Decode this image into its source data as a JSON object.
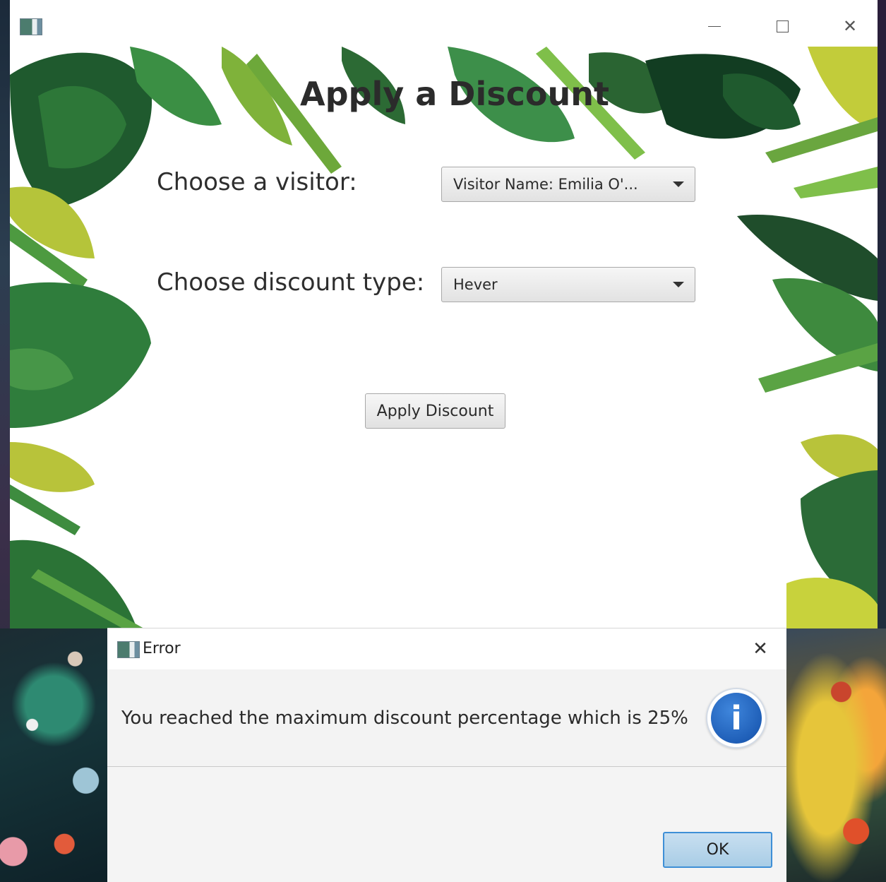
{
  "main_window": {
    "heading": "Apply a Discount",
    "visitor_label": "Choose a visitor:",
    "visitor_selected": "Visitor Name: Emilia O'...",
    "discount_label": "Choose discount type:",
    "discount_selected": "Hever",
    "apply_button": "Apply Discount",
    "controls": {
      "minimize_icon": "minimize-icon",
      "maximize_icon": "maximize-icon",
      "close_icon": "close-icon",
      "close_glyph": "✕"
    }
  },
  "dialog": {
    "title": "Error",
    "close_glyph": "✕",
    "message": "You reached the maximum discount percentage which is 25%",
    "icon": "info-icon",
    "icon_glyph": "i",
    "ok_button": "OK"
  },
  "colors": {
    "leaf_dark": "#1f4d2b",
    "leaf_mid": "#3d8a3a",
    "leaf_light": "#7fbf4a",
    "leaf_yellow": "#b9c93a",
    "ok_button_border": "#3e8fd6",
    "info_icon_blue": "#1f5fb8"
  }
}
